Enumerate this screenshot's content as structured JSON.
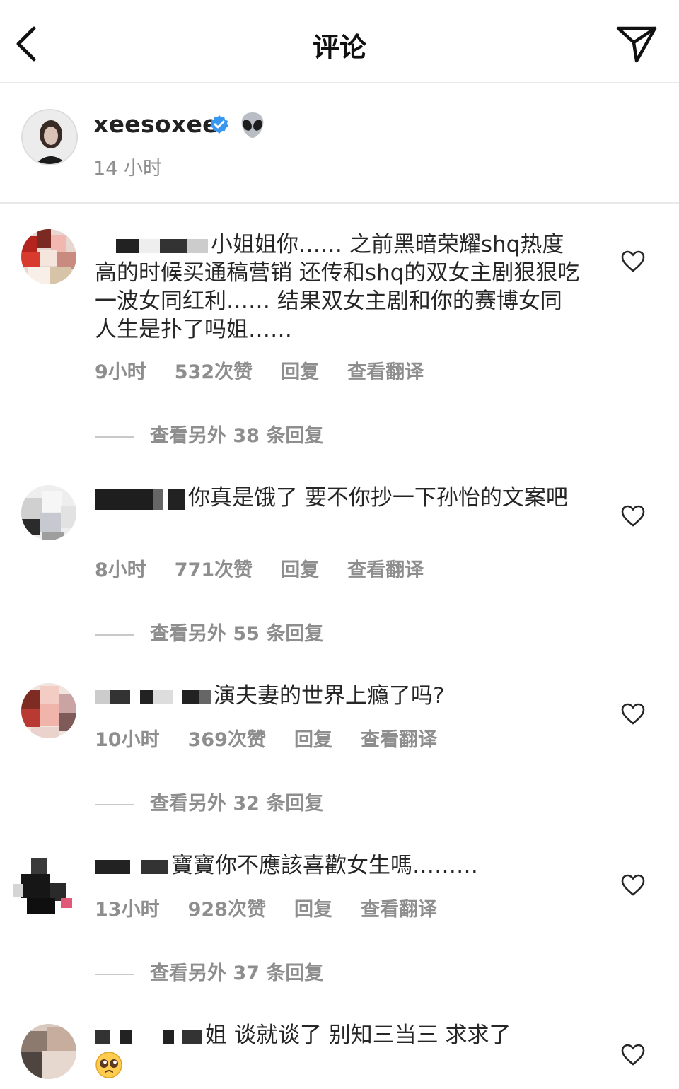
{
  "header": {
    "title": "评论",
    "back_icon": "chevron-left-icon",
    "share_icon": "send-icon"
  },
  "post": {
    "username": "xeesoxee",
    "time": "14 小时",
    "verified_icon": "verified-badge-icon",
    "emoji": "alien-emoji",
    "accent": "#3897f0"
  },
  "comments": [
    {
      "text": "小姐姐你…… 之前黑暗荣耀shq热度高的时候买通稿营销 还传和shq的双女主剧狠狠吃一波女同红利…… 结果双女主剧和你的赛博女同人生是扑了吗姐……",
      "time": "9小时",
      "likes": "532次赞",
      "reply": "回复",
      "translate": "查看翻译",
      "more_replies": "查看另外 38 条回复"
    },
    {
      "text": "你真是饿了 要不你抄一下孙怡的文案吧",
      "time": "8小时",
      "likes": "771次赞",
      "reply": "回复",
      "translate": "查看翻译",
      "more_replies": "查看另外 55 条回复"
    },
    {
      "text": "演夫妻的世界上瘾了吗?",
      "time": "10小时",
      "likes": "369次赞",
      "reply": "回复",
      "translate": "查看翻译",
      "more_replies": "查看另外 32 条回复"
    },
    {
      "text": "寶寶你不應該喜歡女生嗎………",
      "time": "13小时",
      "likes": "928次赞",
      "reply": "回复",
      "translate": "查看翻译",
      "more_replies": "查看另外 37 条回复"
    },
    {
      "text": "姐 谈就谈了 别知三当三 求求了",
      "emoji": "pleading-face-emoji"
    }
  ]
}
